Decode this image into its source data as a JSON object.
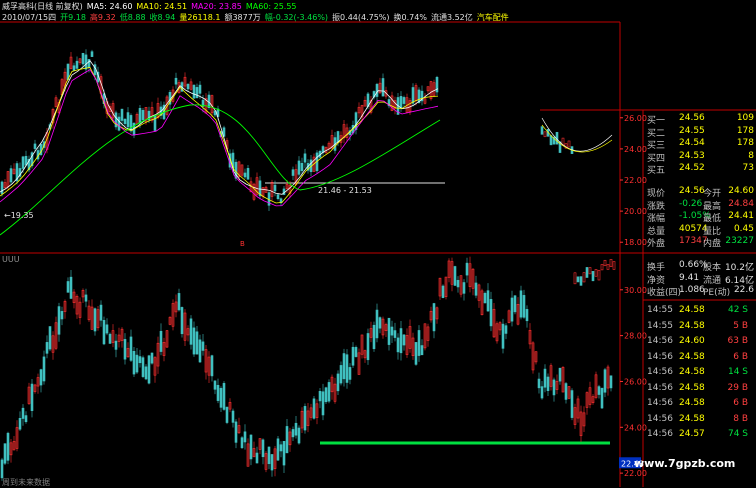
{
  "header": {
    "line1": [
      {
        "text": "威孚高科(日线 前复权)",
        "color": "#e0e0e0"
      },
      {
        "text": "MA5: 24.60",
        "color": "#ffffff"
      },
      {
        "text": "MA10: 24.51",
        "color": "#ffff00"
      },
      {
        "text": "MA20: 23.85",
        "color": "#ff00ff"
      },
      {
        "text": "MA60: 25.55",
        "color": "#00ff00"
      }
    ],
    "line2": [
      {
        "text": "2010/07/15四",
        "color": "#e0e0e0"
      },
      {
        "text": "开9.18",
        "color": "#00e040"
      },
      {
        "text": "高9.32",
        "color": "#ff4040"
      },
      {
        "text": "低8.88",
        "color": "#00e040"
      },
      {
        "text": "收8.94",
        "color": "#00e040"
      },
      {
        "text": "量26118.1",
        "color": "#ffff00"
      },
      {
        "text": "额3877万",
        "color": "#e0e0e0"
      },
      {
        "text": "幅-0.32(-3.46%)",
        "color": "#00e040"
      },
      {
        "text": "振0.44(4.75%)",
        "color": "#e0e0e0"
      },
      {
        "text": "换0.74%",
        "color": "#e0e0e0"
      },
      {
        "text": "流通3.52亿",
        "color": "#e0e0e0"
      },
      {
        "text": "汽车配件",
        "color": "#ffff00"
      }
    ]
  },
  "annotations": {
    "low_label": "←19.35",
    "range_label": "21.46 - 21.53",
    "marker": "B",
    "sub_label": "UUU",
    "bottom_text": "周到未来数据",
    "watermark": "www.7gpzb.com"
  },
  "colors": {
    "up": "#ff3030",
    "down": "#40c0c0",
    "ma5": "#ffffff",
    "ma10": "#ffff00",
    "ma20": "#ff00ff",
    "ma60": "#00ff00",
    "grid": "#c00000"
  },
  "chart_data": [
    {
      "type": "line",
      "name": "intraday_price",
      "y_ticks": [
        "26.00",
        "24.00",
        "22.00",
        "20.00",
        "18.00"
      ],
      "ylim": [
        17.5,
        26.5
      ]
    },
    {
      "type": "bar",
      "name": "lower_candles",
      "y_ticks": [
        "30.00",
        "28.00",
        "26.00",
        "24.00",
        "22.00"
      ],
      "ylim": [
        21.7,
        31.3
      ],
      "current": "22.43"
    }
  ],
  "quote": {
    "sell_bid": [
      {
        "label": "买一",
        "price": "24.56",
        "vol": "109"
      },
      {
        "label": "买二",
        "price": "24.55",
        "vol": "178"
      },
      {
        "label": "买三",
        "price": "24.54",
        "vol": "178"
      },
      {
        "label": "买四",
        "price": "24.53",
        "vol": "8"
      },
      {
        "label": "买五",
        "price": "24.52",
        "vol": "73"
      }
    ],
    "stats": [
      {
        "l1": "现价",
        "v1": "24.56",
        "c1": "y",
        "l2": "今开",
        "v2": "24.60",
        "c2": "y"
      },
      {
        "l1": "涨跌",
        "v1": "-0.26",
        "c1": "g",
        "l2": "最高",
        "v2": "24.84",
        "c2": "r"
      },
      {
        "l1": "涨幅",
        "v1": "-1.05%",
        "c1": "g",
        "l2": "最低",
        "v2": "24.41",
        "c2": "y"
      },
      {
        "l1": "总量",
        "v1": "40574",
        "c1": "y",
        "l2": "量比",
        "v2": "0.45",
        "c2": "y"
      },
      {
        "l1": "外盘",
        "v1": "17347",
        "c1": "r",
        "l2": "内盘",
        "v2": "23227",
        "c2": "g"
      }
    ],
    "info": [
      {
        "l1": "换手",
        "v1": "0.66%",
        "l2": "股本",
        "v2": "10.2亿"
      },
      {
        "l1": "净资",
        "v1": "9.41",
        "l2": "流通",
        "v2": "6.14亿"
      },
      {
        "l1": "收益(四)",
        "v1": "1.086",
        "l2": "PE(动)",
        "v2": "22.6"
      }
    ],
    "ticks": [
      {
        "t": "14:55",
        "p": "24.58",
        "v": "42",
        "s": "S"
      },
      {
        "t": "14:55",
        "p": "24.58",
        "v": "5",
        "s": "B"
      },
      {
        "t": "14:56",
        "p": "24.60",
        "v": "63",
        "s": "B"
      },
      {
        "t": "14:56",
        "p": "24.58",
        "v": "6",
        "s": "B"
      },
      {
        "t": "14:56",
        "p": "24.58",
        "v": "14",
        "s": "S"
      },
      {
        "t": "14:56",
        "p": "24.58",
        "v": "29",
        "s": "B"
      },
      {
        "t": "14:56",
        "p": "24.58",
        "v": "6",
        "s": "B"
      },
      {
        "t": "14:56",
        "p": "24.58",
        "v": "8",
        "s": "B"
      },
      {
        "t": "14:56",
        "p": "24.57",
        "v": "74",
        "s": "S"
      }
    ]
  }
}
